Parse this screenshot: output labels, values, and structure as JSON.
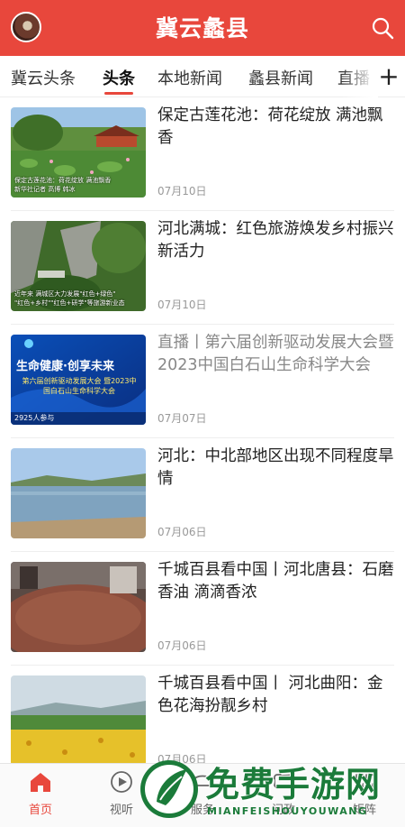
{
  "header": {
    "title": "冀云蠡县",
    "search_icon": "search-icon",
    "avatar_icon": "user-avatar"
  },
  "tabs": [
    {
      "label": "冀云头条",
      "active": false
    },
    {
      "label": "头条",
      "active": true
    },
    {
      "label": "本地新闻",
      "active": false
    },
    {
      "label": "蠡县新闻",
      "active": false
    },
    {
      "label": "直播",
      "active": false
    }
  ],
  "tab_add_label": "+",
  "feed": [
    {
      "headline": "保定古莲花池：荷花绽放 满池飘香",
      "date": "07月10日",
      "thumb_caption": "保定古莲花池：荷花绽放 满池飘香",
      "thumb_subcaption": "新华社记者 高博 韩冰"
    },
    {
      "headline": "河北满城：红色旅游焕发乡村振兴新活力",
      "date": "07月10日",
      "thumb_caption": "近年来 满城区大力发展\"红色+绿色\"",
      "thumb_subcaption": "\"红色+乡村\"\"红色+研学\"等旅游新业态"
    },
    {
      "headline": "直播丨第六届创新驱动发展大会暨2023中国白石山生命科学大会",
      "date": "07月07日",
      "dim": true,
      "thumb_caption": "生命健康·创享未来",
      "thumb_subcaption": "第六届创新驱动发展大会 暨2023中国白石山生命科学大会",
      "thumb_viewers": "2925人参与"
    },
    {
      "headline": "河北：中北部地区出现不同程度旱情",
      "date": "07月06日"
    },
    {
      "headline": "千城百县看中国丨河北唐县：石磨香油 滴滴香浓",
      "date": "07月06日"
    },
    {
      "headline": "千城百县看中国丨 河北曲阳：金色花海扮靓乡村",
      "date": "07月06日"
    }
  ],
  "bottom_nav": [
    {
      "label": "首页",
      "icon": "home-icon",
      "active": true
    },
    {
      "label": "视听",
      "icon": "play-icon",
      "active": false
    },
    {
      "label": "服务",
      "icon": "service-icon",
      "active": false
    },
    {
      "label": "问政",
      "icon": "chat-icon",
      "active": false
    },
    {
      "label": "矩阵",
      "icon": "grid-icon",
      "active": false
    }
  ],
  "watermark": {
    "title": "免费手游网",
    "subtitle": "MIANFEISHOUYOUWANG"
  },
  "colors": {
    "brand_red": "#e8473c",
    "watermark_green": "#1b7b3a"
  }
}
